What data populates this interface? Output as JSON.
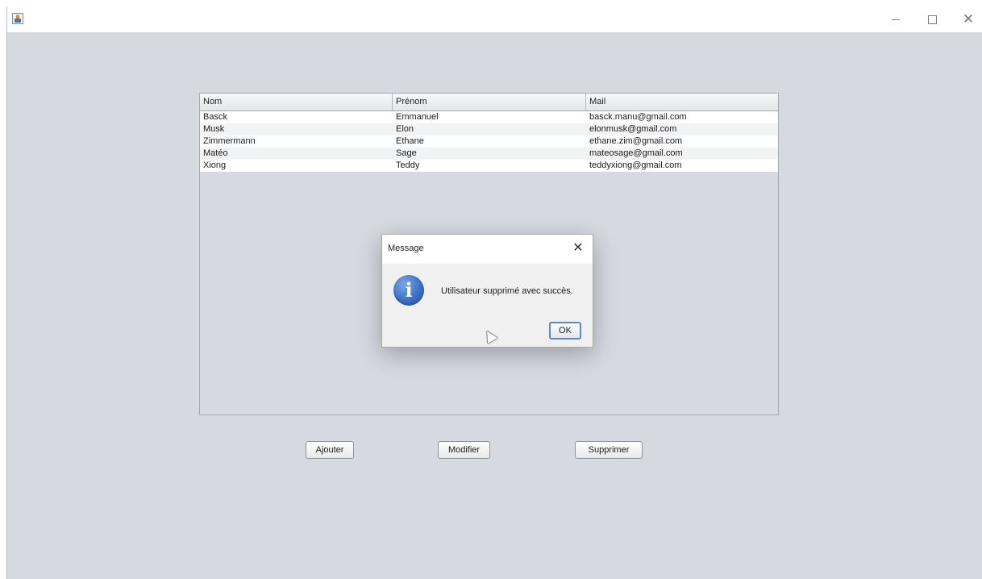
{
  "window": {
    "title": "",
    "minimize_label": "–",
    "close_label": "✕",
    "icons": {
      "app": "java-app-icon",
      "minimize": "minimize-icon",
      "maximize": "maximize-icon",
      "close": "close-icon"
    }
  },
  "table": {
    "columns": [
      "Nom",
      "Prénom",
      "Mail"
    ],
    "rows": [
      [
        "Basck",
        "Emmanuel",
        "basck.manu@gmail.com"
      ],
      [
        "Musk",
        "Elon",
        "elonmusk@gmail.com"
      ],
      [
        "Zimmermann",
        "Ethane",
        "ethane.zim@gmail.com"
      ],
      [
        "Matéo",
        "Sage",
        "mateosage@gmail.com"
      ],
      [
        "Xiong",
        "Teddy",
        "teddyxiong@gmail.com"
      ]
    ]
  },
  "buttons": {
    "ajouter": "Ajouter",
    "modifier": "Modifier",
    "supprimer": "Supprimer"
  },
  "dialog": {
    "title": "Message",
    "close_label": "✕",
    "message": "Utilisateur supprimé avec succès.",
    "ok_label": "OK",
    "icon": "information-icon",
    "icon_glyph": "i"
  }
}
